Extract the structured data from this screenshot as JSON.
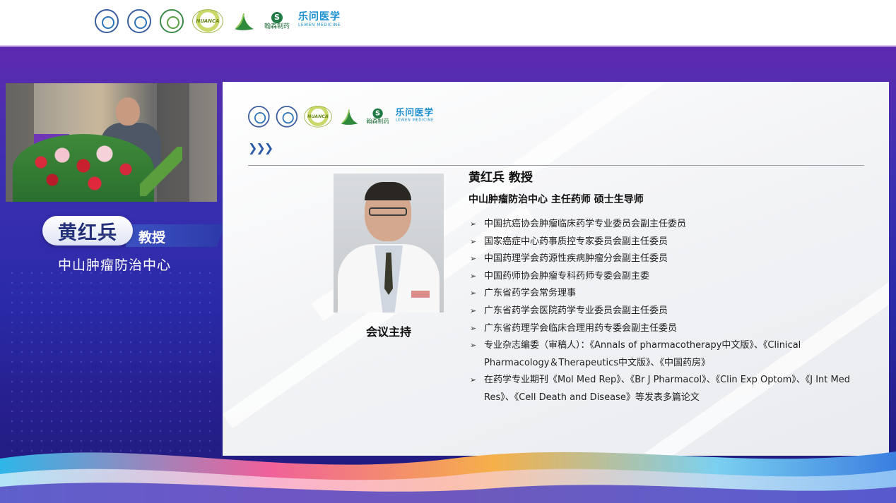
{
  "top_logos": {
    "logos": [
      "university-seal-logo",
      "hospital-association-logo",
      "pharmacy-association-logo",
      "nuanca-logo",
      "leaf-logo",
      "hansen-pharma-logo",
      "lewen-medicine-logo"
    ],
    "hansen_label": "翰森制药",
    "lewen_cn": "乐问医学",
    "lewen_en": "LEWEN MEDICINE"
  },
  "speaker": {
    "name": "黄红兵",
    "title": "教授",
    "organization": "中山肿瘤防治中心"
  },
  "slide": {
    "logos_repeat": true,
    "chevron_glyphs": "❯❯❯",
    "profile_name": "黄红兵 教授",
    "profile_position": "中山肿瘤防治中心  主任药师  硕士生导师",
    "photo_caption": "会议主持",
    "bullets": [
      "中国抗癌协会肿瘤临床药学专业委员会副主任委员",
      "国家癌症中心药事质控专家委员会副主任委员",
      "中国药理学会药源性疾病肿瘤分会副主任委员",
      "中国药师协会肿瘤专科药师专委会副主委",
      "广东省药学会常务理事",
      "广东省药学会医院药学专业委员会副主任委员",
      "广东省药理学会临床合理用药专委会副主任委员",
      "专业杂志编委（审稿人）：《Annals of pharmacotherapy中文版》、《Clinical Pharmacology＆Therapeutics中文版》、《中国药房》",
      "在药学专业期刊《Mol Med Rep》、《Br J Pharmacol》、《Clin Exp Optom》、《J Int Med Res》、《Cell Death and Disease》等发表多篇论文"
    ]
  },
  "colors": {
    "background_top": "#6a22a8",
    "background_bottom": "#1e1a7a",
    "accent_blue": "#2b5aa8",
    "nameplate_text": "#24307a"
  }
}
